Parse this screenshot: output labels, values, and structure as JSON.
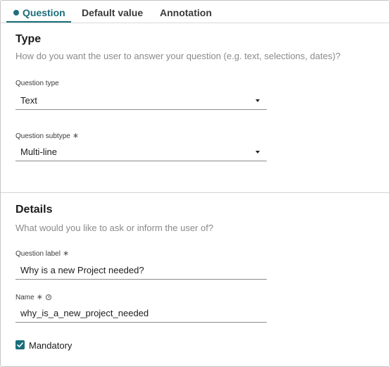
{
  "tabs": [
    {
      "label": "Question",
      "active": true
    },
    {
      "label": "Default value",
      "active": false
    },
    {
      "label": "Annotation",
      "active": false
    }
  ],
  "type_section": {
    "title": "Type",
    "subtitle": "How do you want the user to answer your question (e.g. text, selections, dates)?",
    "question_type": {
      "label": "Question type",
      "value": "Text"
    },
    "question_subtype": {
      "label": "Question subtype",
      "required_mark": "∗",
      "value": "Multi-line"
    }
  },
  "details_section": {
    "title": "Details",
    "subtitle": "What would you like to ask or inform the user of?",
    "question_label": {
      "label": "Question label",
      "required_mark": "∗",
      "value": "Why is a new Project needed?"
    },
    "name": {
      "label": "Name",
      "required_mark": "∗",
      "value": "why_is_a_new_project_needed"
    },
    "mandatory": {
      "label": "Mandatory",
      "checked": true
    }
  },
  "colors": {
    "accent": "#1b6e7a"
  }
}
